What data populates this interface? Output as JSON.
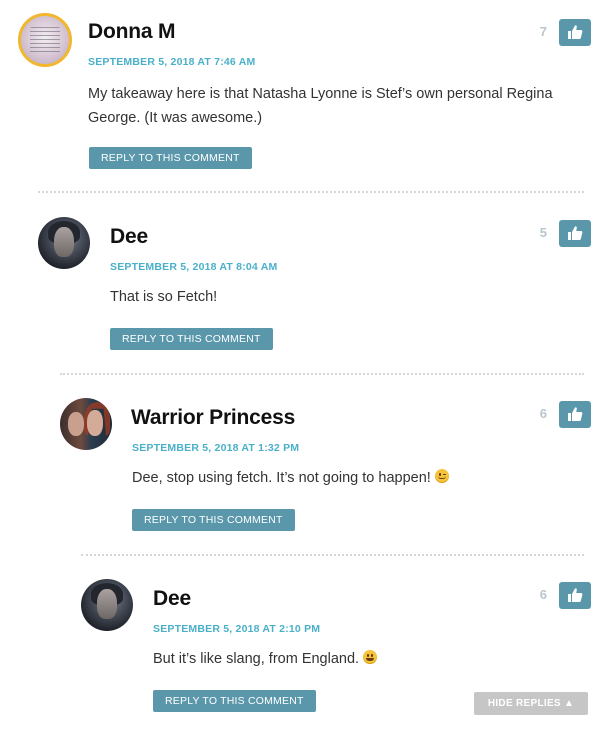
{
  "comments": [
    {
      "author": "Donna M",
      "date": "SEPTEMBER 5, 2018 AT 7:46 AM",
      "text": "My takeaway here is that Natasha Lyonne is Stef’s own personal Regina George. (It was awesome.)",
      "emoji": "",
      "reply_label": "REPLY TO THIS COMMENT",
      "likes": "7",
      "avatar": "donna-avatar"
    },
    {
      "author": "Dee",
      "date": "SEPTEMBER 5, 2018 AT 8:04 AM",
      "text": "That is so Fetch!",
      "emoji": "",
      "reply_label": "REPLY TO THIS COMMENT",
      "likes": "5",
      "avatar": "dee-avatar"
    },
    {
      "author": "Warrior Princess",
      "date": "SEPTEMBER 5, 2018 AT 1:32 PM",
      "text": "Dee, stop using fetch. It’s not going to happen!",
      "emoji": "wink-emoji",
      "reply_label": "REPLY TO THIS COMMENT",
      "likes": "6",
      "avatar": "warrior-princess-avatar"
    },
    {
      "author": "Dee",
      "date": "SEPTEMBER 5, 2018 AT 2:10 PM",
      "text": "But it’s like slang, from England.",
      "emoji": "grin-emoji",
      "reply_label": "REPLY TO THIS COMMENT",
      "likes": "6",
      "avatar": "dee-avatar"
    }
  ],
  "hide_replies_label": "HIDE REPLIES ▲",
  "colors": {
    "accent": "#5b97ab",
    "date": "#4ab0c9",
    "avatar_ring": "#f2b62f",
    "hide_button": "#c6c6c6"
  },
  "icons": {
    "like": "thumbs-up-icon"
  }
}
